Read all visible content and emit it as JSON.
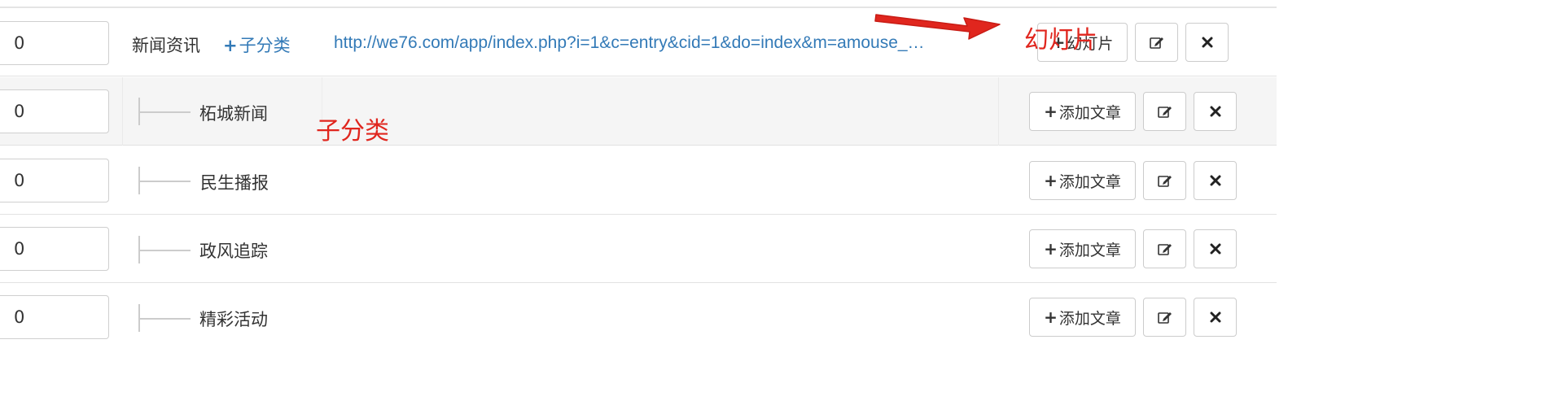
{
  "categories": [
    {
      "order": "0",
      "name": "新闻资讯",
      "add_sub_label": "子分类",
      "url": "http://we76.com/app/index.php?i=1&c=entry&cid=1&do=index&m=amouse_…",
      "action_label": "幻灯片"
    },
    {
      "order": "0",
      "name": "柘城新闻",
      "action_label": "添加文章"
    },
    {
      "order": "0",
      "name": "民生播报",
      "action_label": "添加文章"
    },
    {
      "order": "0",
      "name": "政风追踪",
      "action_label": "添加文章"
    },
    {
      "order": "0",
      "name": "精彩活动",
      "action_label": "添加文章"
    }
  ],
  "icons": {
    "plus": "+",
    "edit": "edit-icon",
    "delete": "close-icon"
  },
  "annotations": {
    "top_right_text": "幻灯片",
    "sub_text": "子分类",
    "color": "#e0261e"
  },
  "colors": {
    "link": "#337ab7",
    "border": "#cccccc",
    "row_shade": "#f5f5f5"
  }
}
